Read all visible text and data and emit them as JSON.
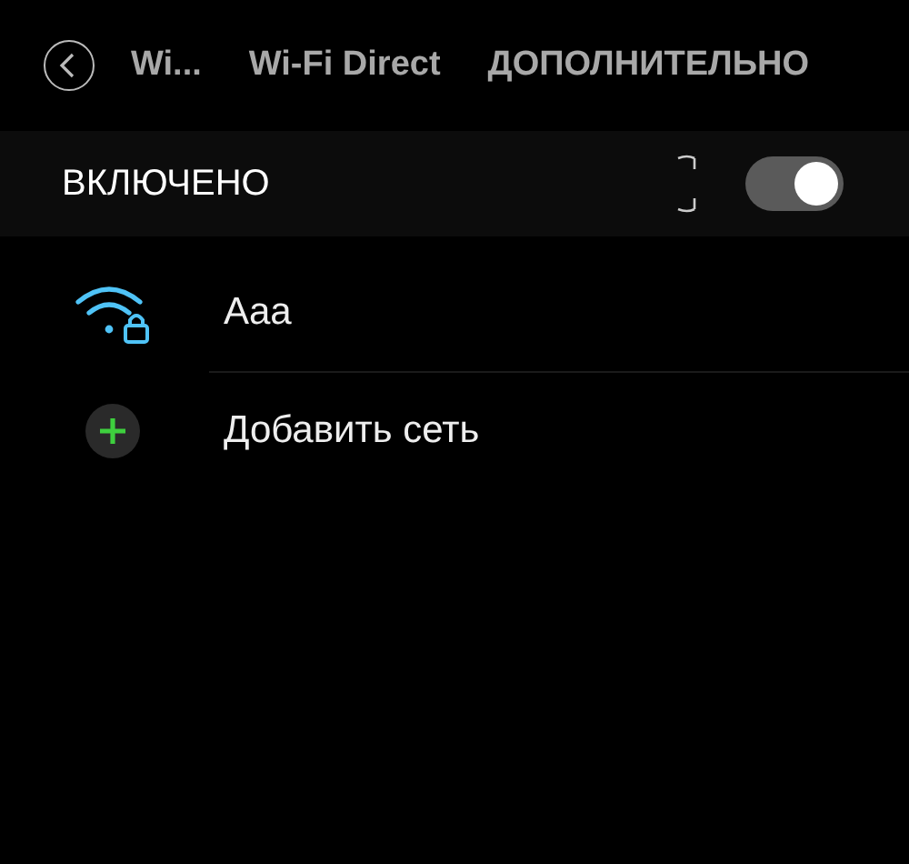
{
  "header": {
    "tabs": [
      "Wi...",
      "Wi-Fi Direct",
      "ДОПОЛНИТЕЛЬНО"
    ]
  },
  "master": {
    "label": "ВКЛЮЧЕНО",
    "on": true,
    "busy": true
  },
  "networks": [
    {
      "kind": "network",
      "name": "Aaa"
    },
    {
      "kind": "add",
      "name": "Добавить сеть"
    }
  ]
}
